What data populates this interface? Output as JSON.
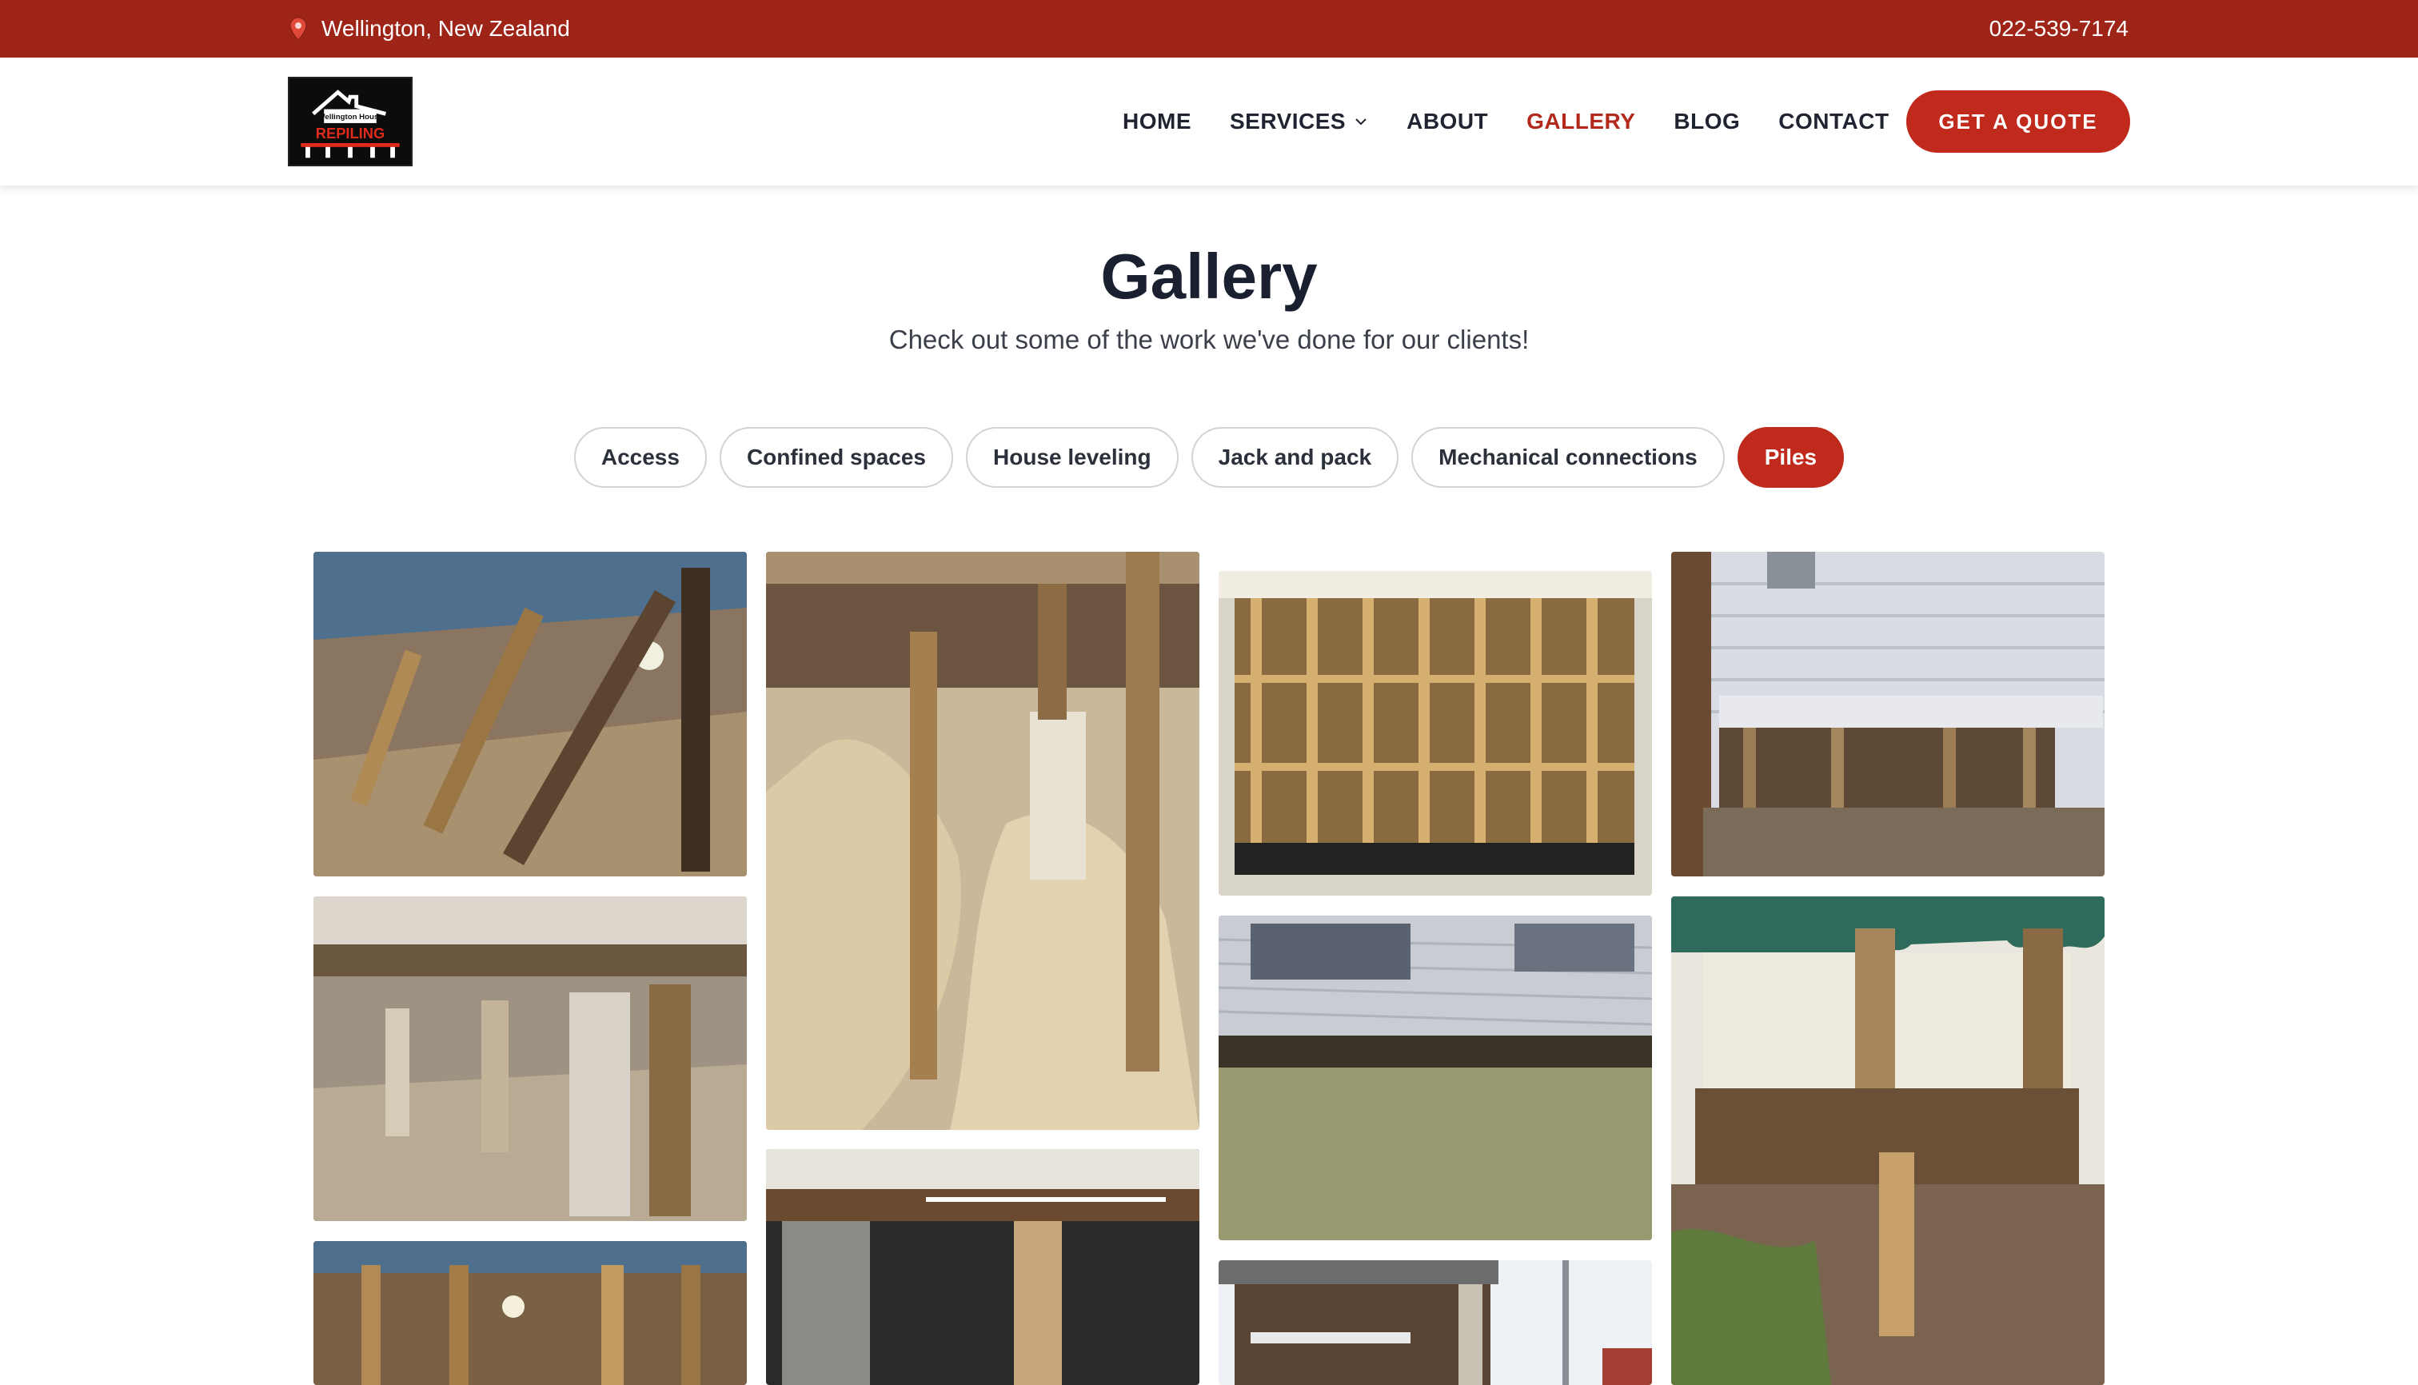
{
  "topbar": {
    "location": "Wellington, New Zealand",
    "location_icon": "map-pin-icon",
    "phone": "022-539-7174"
  },
  "logo": {
    "line1": "Wellington House",
    "line2": "REPILING"
  },
  "nav": {
    "items": [
      {
        "label": "HOME"
      },
      {
        "label": "SERVICES"
      },
      {
        "label": "ABOUT"
      },
      {
        "label": "GALLERY"
      },
      {
        "label": "BLOG"
      },
      {
        "label": "CONTACT"
      }
    ],
    "active": "GALLERY",
    "cta": "GET A QUOTE"
  },
  "page": {
    "title": "Gallery",
    "subtitle": "Check out some of the work we've done for our clients!"
  },
  "filters": {
    "items": [
      {
        "label": "Access"
      },
      {
        "label": "Confined spaces"
      },
      {
        "label": "House leveling"
      },
      {
        "label": "Jack and pack"
      },
      {
        "label": "Mechanical connections"
      },
      {
        "label": "Piles"
      }
    ],
    "active": "Piles"
  },
  "colors": {
    "brand_red": "#bf2a1c",
    "topbar_red": "#9e2418",
    "text_dark": "#1f2430"
  }
}
